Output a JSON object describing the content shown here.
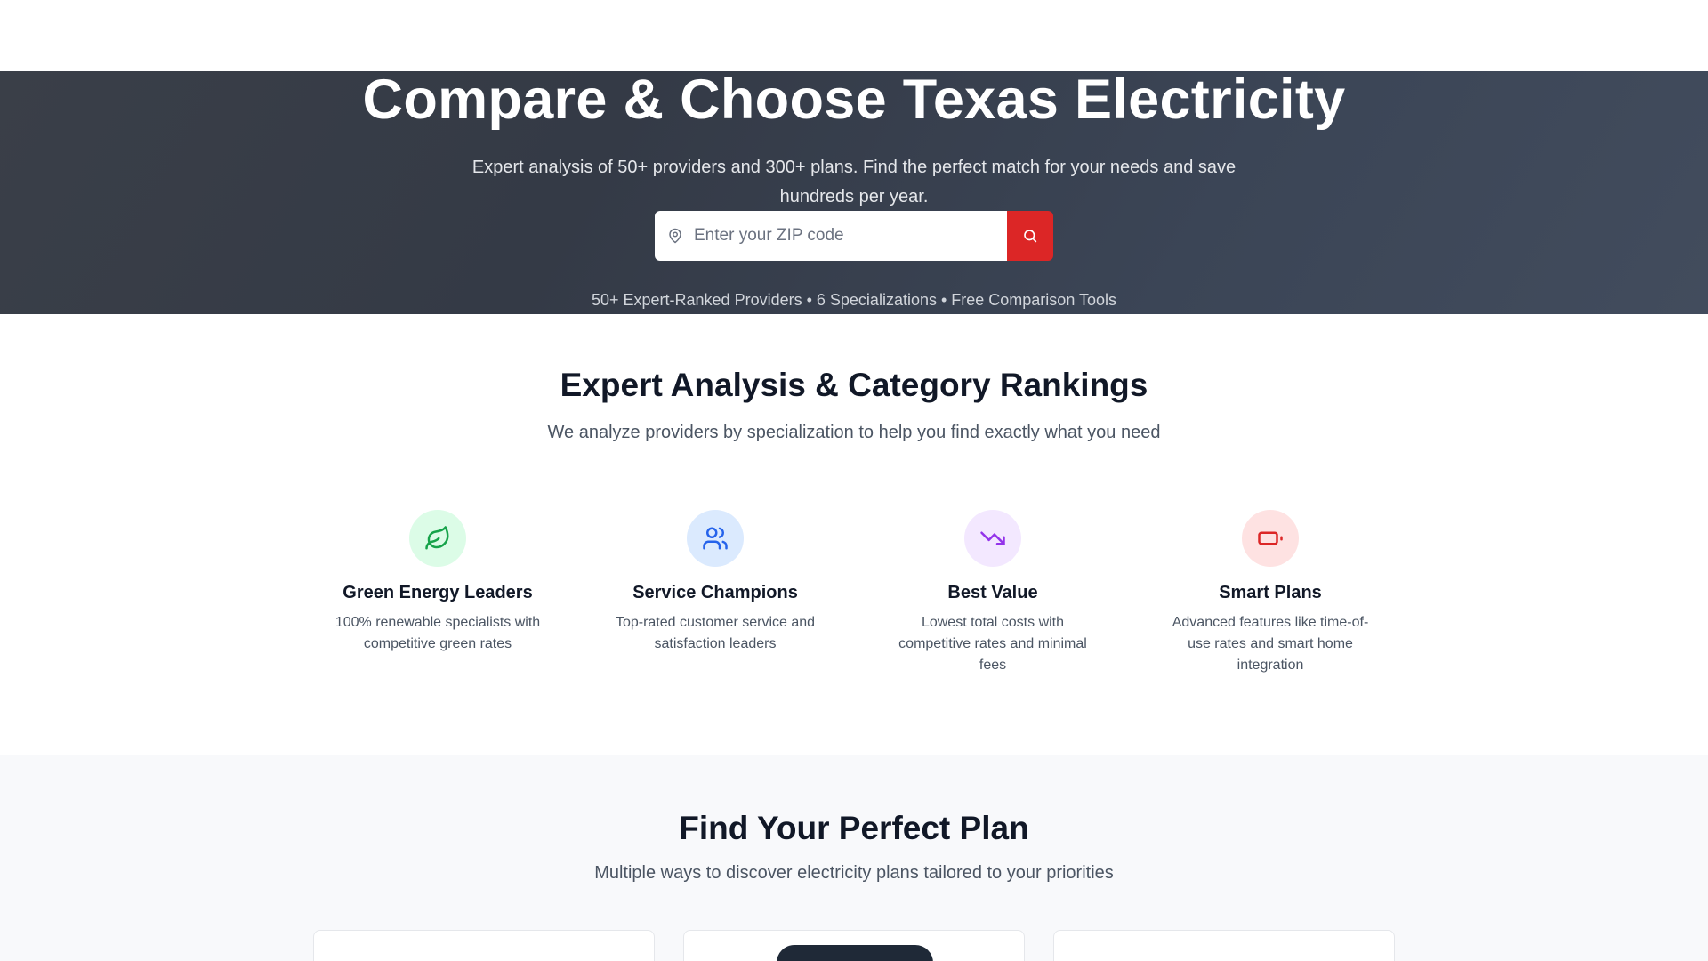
{
  "hero": {
    "title": "Compare & Choose Texas Electricity",
    "subtitle": "Expert analysis of 50+ providers and 300+ plans. Find the perfect match for your needs and save hundreds per year.",
    "zip_placeholder": "Enter your ZIP code",
    "stats": "50+ Expert-Ranked Providers • 6 Specializations • Free Comparison Tools",
    "icons": {
      "location": "map-pin-icon",
      "search": "search-icon"
    },
    "accent_color": "#dc2626"
  },
  "analysis": {
    "title": "Expert Analysis & Category Rankings",
    "subtitle": "We analyze providers by specialization to help you find exactly what you need",
    "categories": [
      {
        "title": "Green Energy Leaders",
        "description": "100% renewable specialists with competitive green rates",
        "icon": "leaf-icon",
        "color": "#16a34a",
        "bg": "#dcfce7"
      },
      {
        "title": "Service Champions",
        "description": "Top-rated customer service and satisfaction leaders",
        "icon": "users-icon",
        "color": "#2563eb",
        "bg": "#dbeafe"
      },
      {
        "title": "Best Value",
        "description": "Lowest total costs with competitive rates and minimal fees",
        "icon": "trending-down-icon",
        "color": "#9333ea",
        "bg": "#f3e8ff"
      },
      {
        "title": "Smart Plans",
        "description": "Advanced features like time-of-use rates and smart home integration",
        "icon": "battery-icon",
        "color": "#dc2626",
        "bg": "#fee2e2"
      }
    ]
  },
  "plans": {
    "title": "Find Your Perfect Plan",
    "subtitle": "Multiple ways to discover electricity plans tailored to your priorities"
  }
}
